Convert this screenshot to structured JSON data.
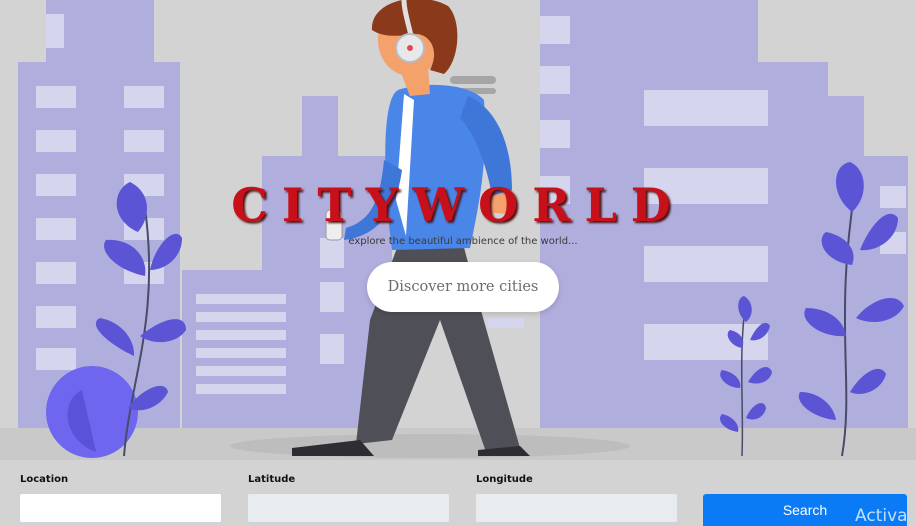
{
  "hero": {
    "brand": "CITYWORLD",
    "tagline": "explore the beautiful ambience of the world...",
    "discover_label": "Discover more cities"
  },
  "form": {
    "location": {
      "label": "Location",
      "value": "",
      "placeholder": ""
    },
    "latitude": {
      "label": "Latitude",
      "value": "",
      "placeholder": ""
    },
    "longitude": {
      "label": "Longitude",
      "value": "",
      "placeholder": ""
    },
    "search_label": "Search"
  },
  "watermark": "Activa",
  "colors": {
    "brand": "#c8101a",
    "buildings": "#b0aedd",
    "plants": "#5b55d6",
    "shirt": "#4a86e8",
    "search_button": "#0b7bf5"
  }
}
